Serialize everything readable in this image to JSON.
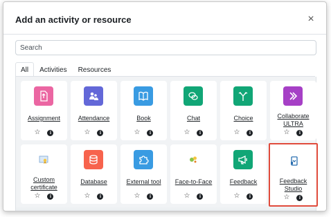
{
  "modal": {
    "title": "Add an activity or resource",
    "close_glyph": "×"
  },
  "search": {
    "placeholder": "Search"
  },
  "tabs": [
    {
      "label": "All",
      "active": true
    },
    {
      "label": "Activities",
      "active": false
    },
    {
      "label": "Resources",
      "active": false
    }
  ],
  "actions": {
    "star_glyph": "☆",
    "info_glyph": "i"
  },
  "tiles": [
    {
      "name": "Assignment",
      "icon": "assignment-icon",
      "color": "#eb66a2"
    },
    {
      "name": "Attendance",
      "icon": "attendance-icon",
      "color": "#6368d8"
    },
    {
      "name": "Book",
      "icon": "book-icon",
      "color": "#399be2"
    },
    {
      "name": "Chat",
      "icon": "chat-icon",
      "color": "#11a676"
    },
    {
      "name": "Choice",
      "icon": "choice-icon",
      "color": "#11a676"
    },
    {
      "name": "Collaborate ULTRA",
      "icon": "collaborate-icon",
      "color": "#a640c6"
    },
    {
      "name": "Custom certificate",
      "icon": "certificate-icon",
      "color": "#f5c542"
    },
    {
      "name": "Database",
      "icon": "database-icon",
      "color": "#f7634d"
    },
    {
      "name": "External tool",
      "icon": "puzzle-icon",
      "color": "#399be2"
    },
    {
      "name": "Face-to-Face",
      "icon": "face-to-face-icon",
      "color": "#8bc34a"
    },
    {
      "name": "Feedback",
      "icon": "megaphone-icon",
      "color": "#11a676"
    },
    {
      "name": "Feedback Studio",
      "icon": "feedback-studio-icon",
      "color": "#2a6fb0"
    }
  ]
}
